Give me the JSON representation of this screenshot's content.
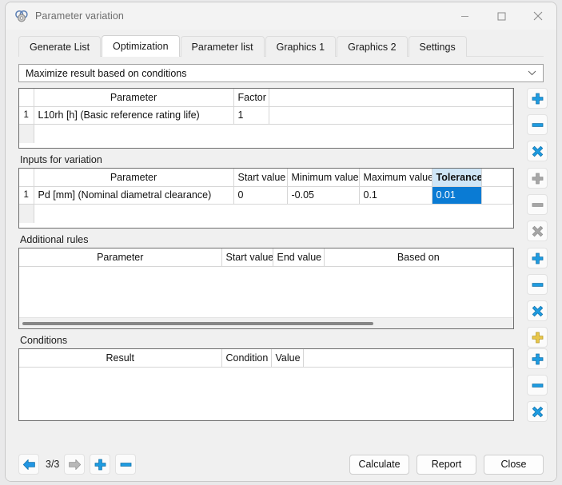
{
  "window": {
    "title": "Parameter variation",
    "icon": "bearing-icon",
    "controls": {
      "minimize": "minimize-icon",
      "maximize": "maximize-icon",
      "close": "close-icon"
    }
  },
  "tabs": [
    {
      "label": "Generate List",
      "active": false
    },
    {
      "label": "Optimization",
      "active": true
    },
    {
      "label": "Parameter list",
      "active": false
    },
    {
      "label": "Graphics 1",
      "active": false
    },
    {
      "label": "Graphics 2",
      "active": false
    },
    {
      "label": "Settings",
      "active": false
    }
  ],
  "mode_select": {
    "value": "Maximize result based on conditions",
    "arrow": "chevron-down-icon"
  },
  "results_table": {
    "headers": [
      "",
      "Parameter",
      "Factor",
      ""
    ],
    "rows": [
      {
        "num": "1",
        "parameter": "L10rh [h]  (Basic reference rating life)",
        "factor": "1"
      }
    ],
    "buttons": [
      {
        "name": "add-result-button",
        "icon": "plus-icon",
        "state": "enabled",
        "color": "#1e9be0"
      },
      {
        "name": "remove-result-button",
        "icon": "minus-icon",
        "state": "enabled",
        "color": "#1e9be0"
      },
      {
        "name": "clear-results-button",
        "icon": "clear-icon",
        "state": "enabled",
        "color": "#1e9be0"
      }
    ]
  },
  "inputs_section": {
    "label": "Inputs for variation",
    "headers": [
      "",
      "Parameter",
      "Start value",
      "Minimum value",
      "Maximum value",
      "Tolerance",
      ""
    ],
    "selected_header": "Tolerance",
    "rows": [
      {
        "num": "1",
        "parameter": "Pd [mm]  (Nominal diametral clearance)",
        "start_value": "0",
        "minimum_value": "-0.05",
        "maximum_value": "0.1",
        "tolerance": "0.01"
      }
    ],
    "buttons": [
      {
        "name": "add-input-button",
        "icon": "plus-icon",
        "state": "disabled",
        "color": "#a6a6a6"
      },
      {
        "name": "remove-input-button",
        "icon": "minus-icon",
        "state": "disabled",
        "color": "#a6a6a6"
      },
      {
        "name": "clear-inputs-button",
        "icon": "clear-icon",
        "state": "disabled",
        "color": "#a6a6a6"
      }
    ]
  },
  "rules_section": {
    "label": "Additional rules",
    "headers": [
      "Parameter",
      "Start value",
      "End value",
      "Based on"
    ],
    "rows": [],
    "scrollbar": {
      "name": "horizontal-scrollbar",
      "thumb_width_pct": "72"
    },
    "buttons": [
      {
        "name": "add-rule-button",
        "icon": "plus-icon",
        "state": "enabled",
        "color": "#1e9be0"
      },
      {
        "name": "remove-rule-button",
        "icon": "minus-icon",
        "state": "enabled",
        "color": "#1e9be0"
      },
      {
        "name": "clear-rules-button",
        "icon": "clear-icon",
        "state": "enabled",
        "color": "#1e9be0"
      },
      {
        "name": "add-rule-alt-button",
        "icon": "plus-icon",
        "state": "enabled",
        "color": "#e8c64a"
      }
    ]
  },
  "conditions_section": {
    "label": "Conditions",
    "headers": [
      "Result",
      "Condition",
      "Value"
    ],
    "rows": [],
    "buttons": [
      {
        "name": "add-condition-button",
        "icon": "plus-icon",
        "state": "enabled",
        "color": "#1e9be0"
      },
      {
        "name": "remove-condition-button",
        "icon": "minus-icon",
        "state": "enabled",
        "color": "#1e9be0"
      },
      {
        "name": "clear-conditions-button",
        "icon": "clear-icon",
        "state": "enabled",
        "color": "#1e9be0"
      }
    ]
  },
  "footer": {
    "prev_icon": "arrow-left-icon",
    "next_icon": "arrow-right-icon",
    "page_indicator": "3/3",
    "add_icon": "plus-icon",
    "remove_icon": "minus-icon",
    "calculate_label": "Calculate",
    "report_label": "Report",
    "close_label": "Close"
  },
  "colors": {
    "accent_blue": "#1e9be0",
    "selection_blue": "#0a7bd4",
    "header_select_blue": "#cfe6f7",
    "yellow": "#e8c64a",
    "disabled_grey": "#a6a6a6",
    "window_bg": "#f0f0f0"
  }
}
